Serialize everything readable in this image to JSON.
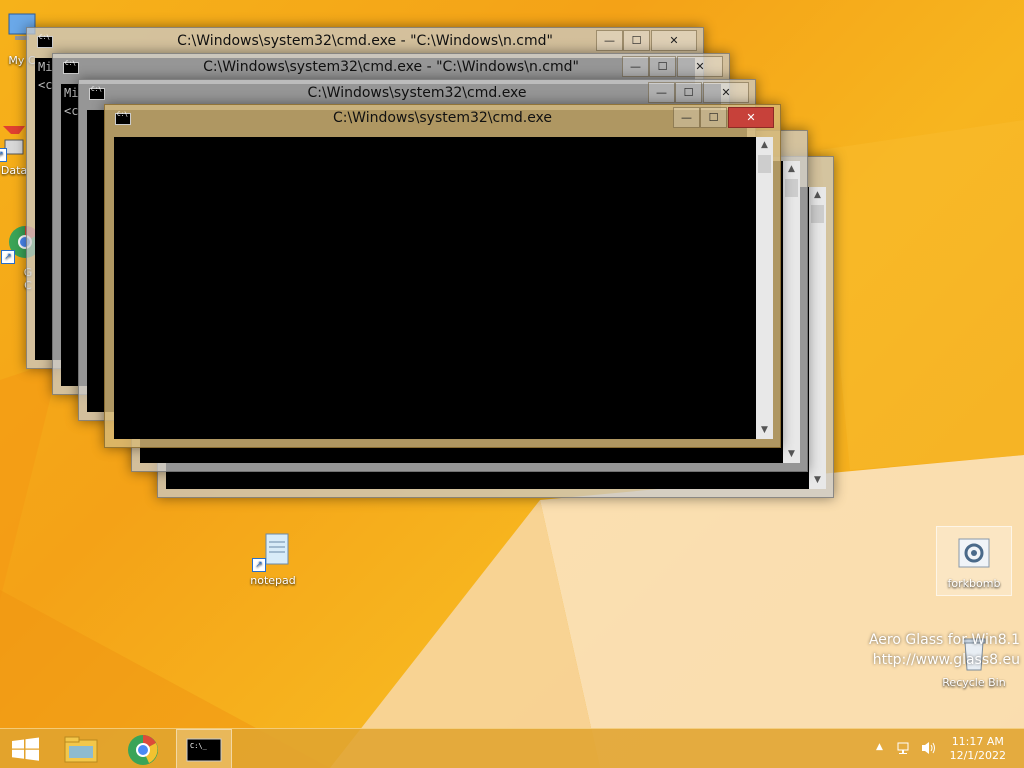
{
  "desktop": {
    "icons": [
      {
        "label": "My C",
        "icon": "computer-icon"
      },
      {
        "label": "Data",
        "icon": "database-shortcut-icon"
      },
      {
        "label": "G",
        "icon": "chrome-shortcut-icon"
      },
      {
        "label": "C",
        "icon": "chrome-shortcut-icon"
      },
      {
        "label": "notepad",
        "icon": "notepad-shortcut-icon"
      },
      {
        "label": "forkbomb",
        "icon": "batch-file-icon"
      },
      {
        "label": "Recycle Bin",
        "icon": "recycle-bin-icon"
      }
    ],
    "watermark": {
      "line1": "Aero Glass for Win8.1",
      "line2": "http://www.glass8.eu"
    }
  },
  "windows": [
    {
      "title": "C:\\Windows\\system32\\cmd.exe - \"C:\\Windows\\n.cmd\"",
      "console_lines": [
        "Mi",
        "<c"
      ]
    },
    {
      "title": "C:\\Windows\\system32\\cmd.exe - \"C:\\Windows\\n.cmd\"",
      "console_lines": [
        "Mi",
        "<c"
      ]
    },
    {
      "title": "C:\\Windows\\system32\\cmd.exe",
      "console_lines": []
    },
    {
      "title": "C:\\Windows\\system32\\cmd.exe",
      "console_lines": []
    }
  ],
  "window_controls": {
    "minimize": "—",
    "maximize": "☐",
    "close": "✕"
  },
  "scroll": {
    "up": "▲",
    "down": "▼"
  },
  "taskbar": {
    "start": "start-icon",
    "pinned": [
      "file-explorer-icon",
      "chrome-icon",
      "cmd-icon"
    ],
    "tray": {
      "chevron": "▲"
    },
    "clock": {
      "time": "11:17 AM",
      "date": "12/1/2022"
    }
  },
  "colors": {
    "accent": "#f4a217",
    "close_active": "#c7413a"
  }
}
